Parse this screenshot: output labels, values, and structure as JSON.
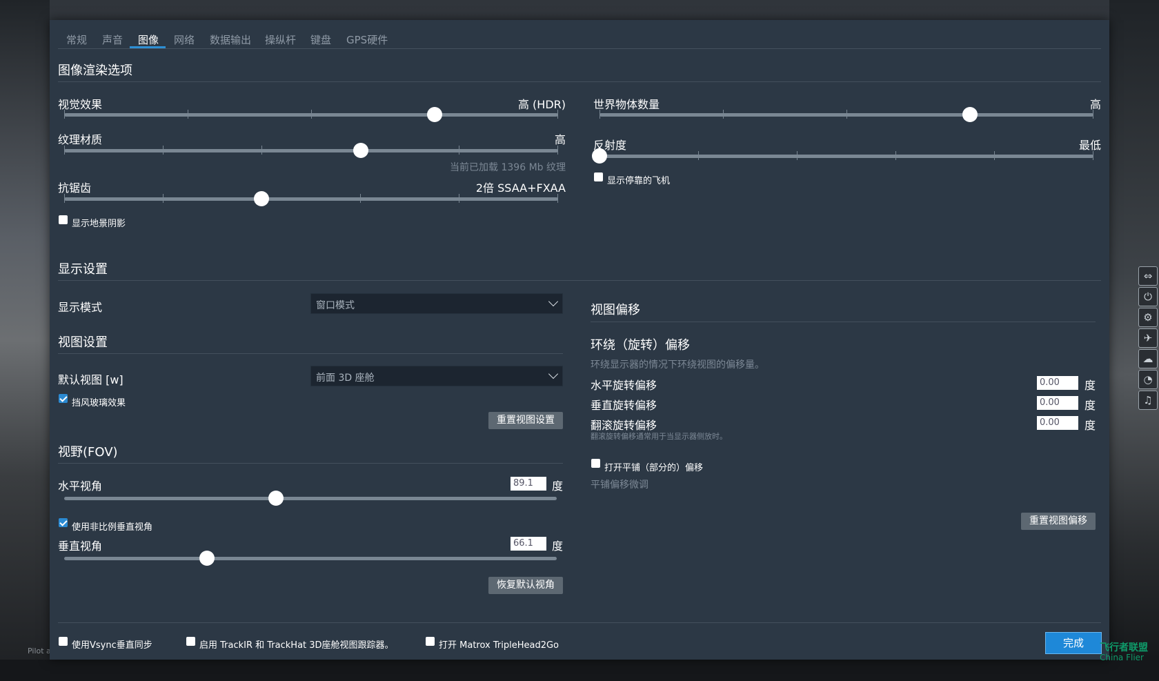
{
  "tabs": [
    "常规",
    "声音",
    "图像",
    "网络",
    "数据输出",
    "操纵杆",
    "键盘",
    "GPS硬件"
  ],
  "active_tab": "图像",
  "render": {
    "heading": "图像渲染选项",
    "visual_effects": {
      "label": "视觉效果",
      "value": "高 (HDR)",
      "level": 0.75
    },
    "texture": {
      "label": "纹理材质",
      "value": "高",
      "level": 0.6,
      "note": "当前已加载 1396 Mb 纹理"
    },
    "antialias": {
      "label": "抗锯齿",
      "value": "2倍 SSAA+FXAA",
      "level": 0.4
    },
    "terrain_shadows": {
      "label": "显示地景阴影",
      "checked": false
    },
    "world_objects": {
      "label": "世界物体数量",
      "value": "高",
      "level": 0.75
    },
    "reflection": {
      "label": "反射度",
      "value": "最低",
      "level": 0.0
    },
    "parked_aircraft": {
      "label": "显示停靠的飞机",
      "checked": false
    }
  },
  "display": {
    "heading": "显示设置",
    "mode_label": "显示模式",
    "mode_value": "窗口模式"
  },
  "view": {
    "heading": "视图设置",
    "default_label": "默认视图 [w]",
    "default_value": "前面 3D 座舱",
    "windshield": {
      "label": "挡风玻璃效果",
      "checked": true
    },
    "reset_button": "重置视图设置"
  },
  "fov": {
    "heading": "视野(FOV)",
    "horizontal_label": "水平视角",
    "horizontal_value": "89.1",
    "horizontal_level": 0.43,
    "unit": "度",
    "nonprop": {
      "label": "使用非比例垂直视角",
      "checked": true
    },
    "vertical_label": "垂直视角",
    "vertical_value": "66.1",
    "vertical_level": 0.29,
    "restore_button": "恢复默认视角"
  },
  "offset": {
    "heading": "视图偏移",
    "surround_heading": "环绕（旋转）偏移",
    "surround_desc": "环绕显示器的情况下环绕视图的偏移量。",
    "rows": [
      {
        "label": "水平旋转偏移",
        "value": "0.00",
        "unit": "度"
      },
      {
        "label": "垂直旋转偏移",
        "value": "0.00",
        "unit": "度"
      },
      {
        "label": "翻滚旋转偏移",
        "value": "0.00",
        "unit": "度"
      }
    ],
    "roll_note": "翻滚旋转偏移通常用于当显示器侧放时。",
    "tile": {
      "label": "打开平铺（部分的）偏移",
      "checked": false
    },
    "tile_fine": "平铺偏移微调",
    "reset_button": "重置视图偏移"
  },
  "footer": {
    "vsync": {
      "label": "使用Vsync垂直同步",
      "checked": false
    },
    "trackir": {
      "label": "启用 TrackIR 和 TrackHat 3D座舱视图跟踪器。",
      "checked": false
    },
    "matrox": {
      "label": "打开 Matrox TripleHead2Go",
      "checked": false
    },
    "done_button": "完成"
  },
  "background_text": {
    "pilot": "Pilot a",
    "watermark": "飞行者联盟",
    "watermark_en": "China Flier"
  },
  "colors": {
    "panel": "#2c3845",
    "accent": "#2d8fd4",
    "track": "#7a8793"
  }
}
